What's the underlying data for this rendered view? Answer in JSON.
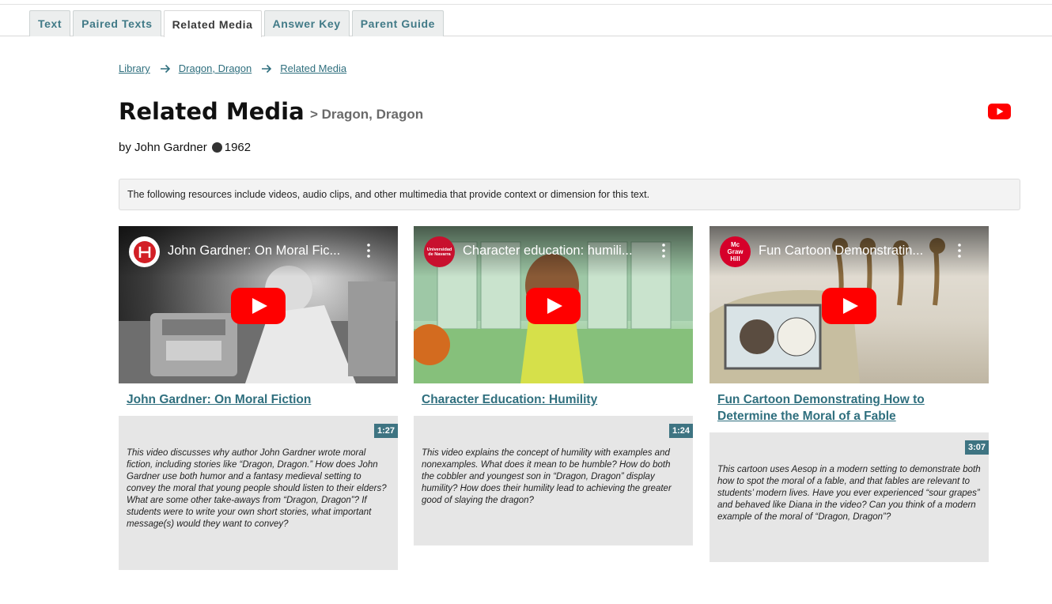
{
  "tabs": [
    {
      "label": "Text",
      "active": false
    },
    {
      "label": "Paired Texts",
      "active": false
    },
    {
      "label": "Related Media",
      "active": true
    },
    {
      "label": "Answer Key",
      "active": false
    },
    {
      "label": "Parent Guide",
      "active": false
    }
  ],
  "breadcrumb": [
    "Library",
    "Dragon, Dragon",
    "Related Media"
  ],
  "page": {
    "title": "Related Media",
    "subtitle": "> Dragon, Dragon",
    "author_line": "by John Gardner",
    "year": "1962",
    "intro": "The following resources include videos, audio clips, and other multimedia that provide context or dimension for this text."
  },
  "icons": {
    "breadcrumb_arrow": "arrow-right-icon",
    "source": "youtube-icon",
    "play": "play-icon",
    "menu": "more-vertical-icon"
  },
  "colors": {
    "accent": "#2f6f7e",
    "duration_badge": "#3e7482",
    "youtube_red": "#ff0000"
  },
  "cards": [
    {
      "video_title": "John Gardner: On Moral Fic...",
      "channel_color": "#d21f26",
      "link": "John Gardner: On Moral Fiction",
      "duration": "1:27",
      "description": "This video discusses why author John Gardner wrote moral fiction, including stories like “Dragon, Dragon.” How does John Gardner use both humor and a fantasy medieval setting to convey the moral that young people should listen to their elders? What are some other take-aways from “Dragon, Dragon”? If students were to write your own short stories, what important message(s) would they want to convey?"
    },
    {
      "video_title": "Character education: humili...",
      "channel_label": "Universidad de Navarra",
      "channel_color": "#c8102e",
      "link": "Character Education: Humility",
      "duration": "1:24",
      "description": "This video explains the concept of humility with examples and nonexamples. What does it mean to be humble? How do both the cobbler and youngest son in “Dragon, Dragon” display humility? How does their humility lead to achieving the greater good of slaying the dragon?"
    },
    {
      "video_title": "Fun Cartoon Demonstratin...",
      "channel_label": "Mc Graw Hill",
      "channel_color": "#d6002a",
      "link": "Fun Cartoon Demonstrating How to Determine the Moral of a Fable",
      "duration": "3:07",
      "description": "This cartoon uses Aesop in a modern setting to demonstrate both how to spot the moral of a fable, and that fables are relevant to students’ modern lives. Have you ever experienced “sour grapes” and behaved like Diana in the video? Can you think of a modern example of the moral of “Dragon, Dragon”?"
    }
  ]
}
